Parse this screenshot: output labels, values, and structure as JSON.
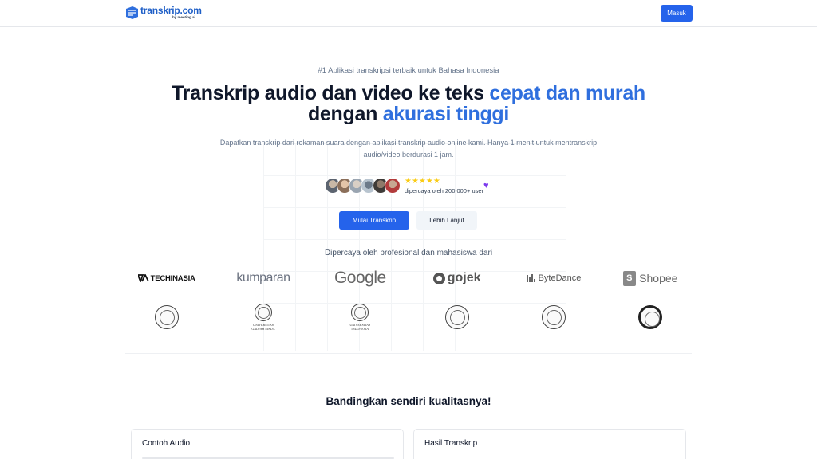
{
  "header": {
    "logo_text": "transkrip.com",
    "logo_subtext": "by meeting.ai",
    "login_label": "Masuk"
  },
  "hero": {
    "tagline": "#1 Aplikasi transkripsi terbaik untuk Bahasa Indonesia",
    "headline_part1": "Transkrip audio dan video ke teks ",
    "headline_highlight1": "cepat dan murah",
    "headline_part2": " dengan ",
    "headline_highlight2": "akurasi tinggi",
    "description": "Dapatkan transkrip dari rekaman suara dengan aplikasi transkrip audio online kami. Hanya 1 menit untuk mentranskrip audio/video berdurasi 1 jam.",
    "stars": "★★★★★",
    "rating_text": "dipercaya oleh 200.000+ user",
    "heart": "♥",
    "primary_button": "Mulai Transkrip",
    "secondary_button": "Lebih Lanjut"
  },
  "trusted": {
    "title": "Dipercaya oleh profesional dan mahasiswa dari",
    "companies": [
      "TECHINASIA",
      "kumparan",
      "Google",
      "gojek",
      "ByteDance",
      "Shopee"
    ],
    "universities": [
      "UNIVERSITAS GADJAH MADA",
      "UNIVERSITAS INDONESIA"
    ]
  },
  "compare": {
    "title": "Bandingkan sendiri kualitasnya!",
    "audio_card_title": "Contoh Audio",
    "result_card_title": "Hasil Transkrip"
  },
  "colors": {
    "accent": "#2563eb",
    "highlight": "#2f6fde",
    "star": "#facc15",
    "heart": "#7c3aed"
  }
}
